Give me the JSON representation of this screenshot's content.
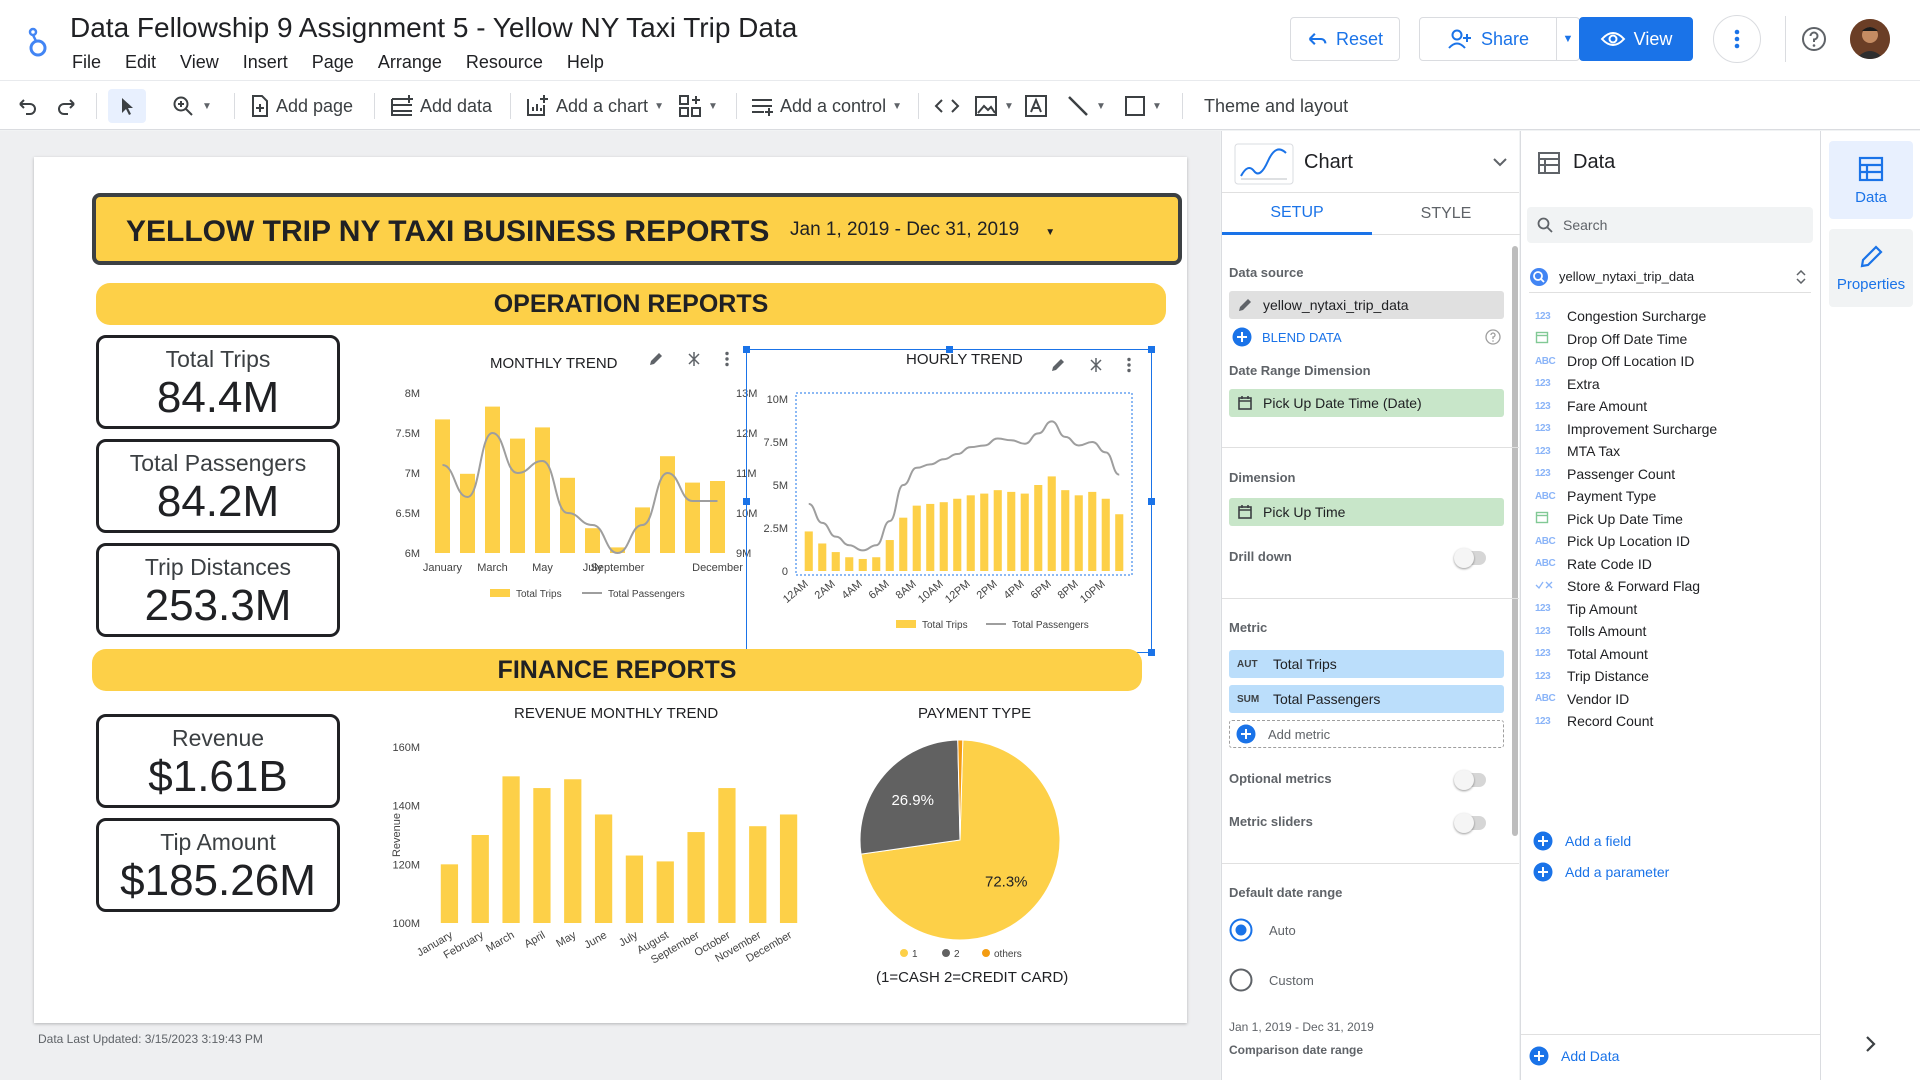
{
  "header": {
    "title": "Data Fellowship 9 Assignment 5 - Yellow NY Taxi Trip Data",
    "menu": [
      "File",
      "Edit",
      "View",
      "Insert",
      "Page",
      "Arrange",
      "Resource",
      "Help"
    ],
    "reset_label": "Reset",
    "share_label": "Share",
    "view_label": "View"
  },
  "toolbar": {
    "add_page": "Add page",
    "add_data": "Add data",
    "add_chart": "Add a chart",
    "add_control": "Add a control",
    "theme_layout": "Theme and layout"
  },
  "report": {
    "banner_title": "YELLOW TRIP NY TAXI BUSINESS REPORTS",
    "date_range": "Jan 1, 2019 - Dec 31, 2019",
    "operation_title": "OPERATION REPORTS",
    "finance_title": "FINANCE REPORTS",
    "kpis": [
      {
        "label": "Total Trips",
        "value": "84.4M"
      },
      {
        "label": "Total Passengers",
        "value": "84.2M"
      },
      {
        "label": "Trip Distances",
        "value": "253.3M"
      },
      {
        "label": "Revenue",
        "value": "$1.61B"
      },
      {
        "label": "Tip Amount",
        "value": "$185.26M"
      }
    ],
    "footer": "Data Last Updated: 3/15/2023 3:19:43 PM",
    "payment_note": "(1=CASH 2=CREDIT CARD)"
  },
  "chart_data": [
    {
      "type": "bar",
      "title": "MONTHLY TREND",
      "categories": [
        "January",
        "February",
        "March",
        "April",
        "May",
        "June",
        "July",
        "August",
        "September",
        "October",
        "November",
        "December"
      ],
      "tick_labels": [
        "January",
        "",
        "March",
        "",
        "May",
        "",
        "July",
        "September",
        "",
        "",
        "",
        "December"
      ],
      "series": [
        {
          "name": "Total Trips",
          "values": [
            7.67,
            6.99,
            7.83,
            7.43,
            7.57,
            6.94,
            6.31,
            6.07,
            6.57,
            7.21,
            6.88,
            6.9
          ]
        },
        {
          "name": "Total Passengers",
          "values": [
            11.2,
            10.4,
            12.0,
            11.0,
            11.3,
            10.0,
            9.7,
            9.0,
            9.7,
            11.0,
            10.3,
            10.3
          ]
        }
      ],
      "left_axis": {
        "ticks": [
          "6M",
          "6.5M",
          "7M",
          "7.5M",
          "8M"
        ],
        "ylim": [
          6,
          8
        ]
      },
      "right_axis": {
        "ticks": [
          "9M",
          "10M",
          "11M",
          "12M",
          "13M"
        ],
        "ylim": [
          9,
          13
        ]
      },
      "legend": "bottom"
    },
    {
      "type": "bar",
      "title": "HOURLY TREND",
      "categories": [
        "12AM",
        "1AM",
        "2AM",
        "3AM",
        "4AM",
        "5AM",
        "6AM",
        "7AM",
        "8AM",
        "9AM",
        "10AM",
        "11AM",
        "12PM",
        "1PM",
        "2PM",
        "3PM",
        "4PM",
        "5PM",
        "6PM",
        "7PM",
        "8PM",
        "9PM",
        "10PM",
        "11PM"
      ],
      "tick_labels": [
        "12AM",
        "2AM",
        "4AM",
        "6AM",
        "8AM",
        "10AM",
        "12PM",
        "2PM",
        "4PM",
        "6PM",
        "8PM",
        "10PM"
      ],
      "series": [
        {
          "name": "Total Trips",
          "values": [
            2.3,
            1.6,
            1.1,
            0.8,
            0.7,
            0.8,
            1.8,
            3.1,
            3.8,
            3.9,
            4.0,
            4.2,
            4.4,
            4.5,
            4.7,
            4.6,
            4.5,
            5.0,
            5.5,
            4.7,
            4.4,
            4.6,
            4.2,
            3.3
          ]
        },
        {
          "name": "Total Passengers",
          "values": [
            3.9,
            2.8,
            2.0,
            1.5,
            1.2,
            1.5,
            2.9,
            5.0,
            6.0,
            6.2,
            6.5,
            6.8,
            7.2,
            7.3,
            7.7,
            7.6,
            7.4,
            8.0,
            8.7,
            7.8,
            7.3,
            7.5,
            6.9,
            5.6
          ]
        }
      ],
      "axis": {
        "ticks": [
          "0",
          "2.5M",
          "5M",
          "7.5M",
          "10M"
        ],
        "ylim": [
          0,
          10
        ]
      },
      "legend": "bottom"
    },
    {
      "type": "bar",
      "title": "REVENUE MONTHLY TREND",
      "ylabel": "Revenue",
      "categories": [
        "January",
        "February",
        "March",
        "April",
        "May",
        "June",
        "July",
        "August",
        "September",
        "October",
        "November",
        "December"
      ],
      "values": [
        120,
        130,
        150,
        146,
        149,
        137,
        123,
        121,
        131,
        146,
        133,
        137
      ],
      "axis": {
        "ticks": [
          "100M",
          "120M",
          "140M",
          "160M"
        ],
        "ylim": [
          100,
          160
        ]
      }
    },
    {
      "type": "pie",
      "title": "PAYMENT TYPE",
      "slices": [
        {
          "name": "1",
          "value": 72.3,
          "label": "72.3%",
          "color": "#fdd048"
        },
        {
          "name": "2",
          "value": 26.9,
          "label": "26.9%",
          "color": "#616161"
        },
        {
          "name": "others",
          "value": 0.8,
          "label": "",
          "color": "#f39c12"
        }
      ],
      "legend": "bottom"
    }
  ],
  "chart_panel": {
    "title": "Chart",
    "tab_setup": "SETUP",
    "tab_style": "STYLE",
    "data_source_label": "Data source",
    "data_source": "yellow_nytaxi_trip_data",
    "blend_label": "BLEND DATA",
    "date_range_dimension_label": "Date Range Dimension",
    "date_range_dimension": "Pick Up Date Time (Date)",
    "dimension_label": "Dimension",
    "dimension": "Pick Up Time",
    "drill_down_label": "Drill down",
    "metric_label": "Metric",
    "metrics": [
      {
        "tag": "AUT",
        "name": "Total Trips"
      },
      {
        "tag": "SUM",
        "name": "Total Passengers"
      }
    ],
    "add_metric": "Add metric",
    "optional_metrics": "Optional metrics",
    "metric_sliders": "Metric sliders",
    "default_date_range": "Default date range",
    "auto": "Auto",
    "custom": "Custom",
    "date_range_text": "Jan 1, 2019 - Dec 31, 2019",
    "comparison_label": "Comparison date range"
  },
  "data_panel": {
    "title": "Data",
    "search_placeholder": "Search",
    "source": "yellow_nytaxi_trip_data",
    "fields": [
      {
        "type": "123",
        "name": "Congestion Surcharge"
      },
      {
        "type": "date",
        "name": "Drop Off Date Time"
      },
      {
        "type": "ABC",
        "name": "Drop Off Location ID"
      },
      {
        "type": "123",
        "name": "Extra"
      },
      {
        "type": "123",
        "name": "Fare Amount"
      },
      {
        "type": "123",
        "name": "Improvement Surcharge"
      },
      {
        "type": "123",
        "name": "MTA Tax"
      },
      {
        "type": "123",
        "name": "Passenger Count"
      },
      {
        "type": "ABC",
        "name": "Payment Type"
      },
      {
        "type": "date",
        "name": "Pick Up Date Time"
      },
      {
        "type": "ABC",
        "name": "Pick Up Location ID"
      },
      {
        "type": "ABC",
        "name": "Rate Code ID"
      },
      {
        "type": "bool",
        "name": "Store & Forward Flag"
      },
      {
        "type": "123",
        "name": "Tip Amount"
      },
      {
        "type": "123",
        "name": "Tolls Amount"
      },
      {
        "type": "123",
        "name": "Total Amount"
      },
      {
        "type": "123",
        "name": "Trip Distance"
      },
      {
        "type": "ABC",
        "name": "Vendor ID"
      },
      {
        "type": "123",
        "name": "Record Count"
      }
    ],
    "add_field": "Add a field",
    "add_parameter": "Add a parameter",
    "add_data": "Add Data"
  },
  "rail": {
    "data_label": "Data",
    "properties_label": "Properties"
  },
  "colors": {
    "accent": "#1a73e8",
    "yellow": "#fdd048",
    "dark": "#616161",
    "orange": "#f39c12"
  }
}
